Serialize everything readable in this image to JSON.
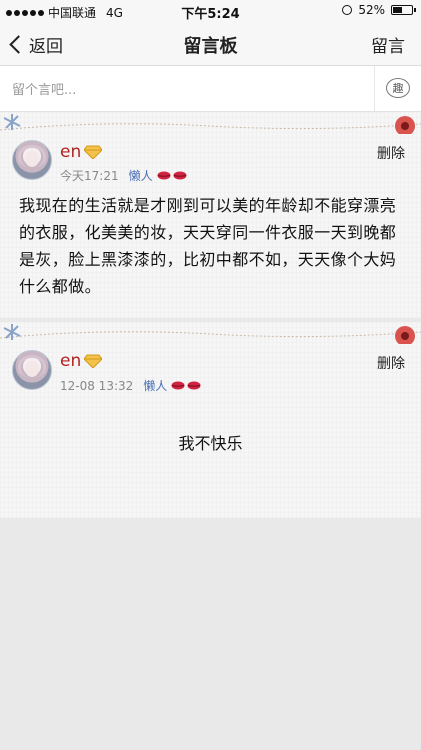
{
  "status_bar": {
    "carrier": "中国联通",
    "network": "4G",
    "time": "下午5:24",
    "battery": "52%",
    "battery_level": 0.52
  },
  "nav": {
    "back_label": "返回",
    "title": "留言板",
    "action_label": "留言"
  },
  "input_bar": {
    "placeholder": "留个言吧...",
    "fun_button_label": "趣"
  },
  "messages": [
    {
      "name": "en",
      "time": "今天17:21",
      "tag": "懒人",
      "delete_label": "删除",
      "content": "我现在的生活就是才刚到可以美的年龄却不能穿漂亮的衣服，化美美的妆，天天穿同一件衣服一天到晚都是灰，脸上黑漆漆的，比初中都不如，天天像个大妈什么都做。"
    },
    {
      "name": "en",
      "time": "12-08 13:32",
      "tag": "懒人",
      "delete_label": "删除",
      "content": "我不快乐"
    }
  ],
  "colors": {
    "name": "#b22222",
    "tag": "#4a6fb5",
    "card_bg": "#f6f6f6",
    "page_bg": "#e9e9e9"
  }
}
